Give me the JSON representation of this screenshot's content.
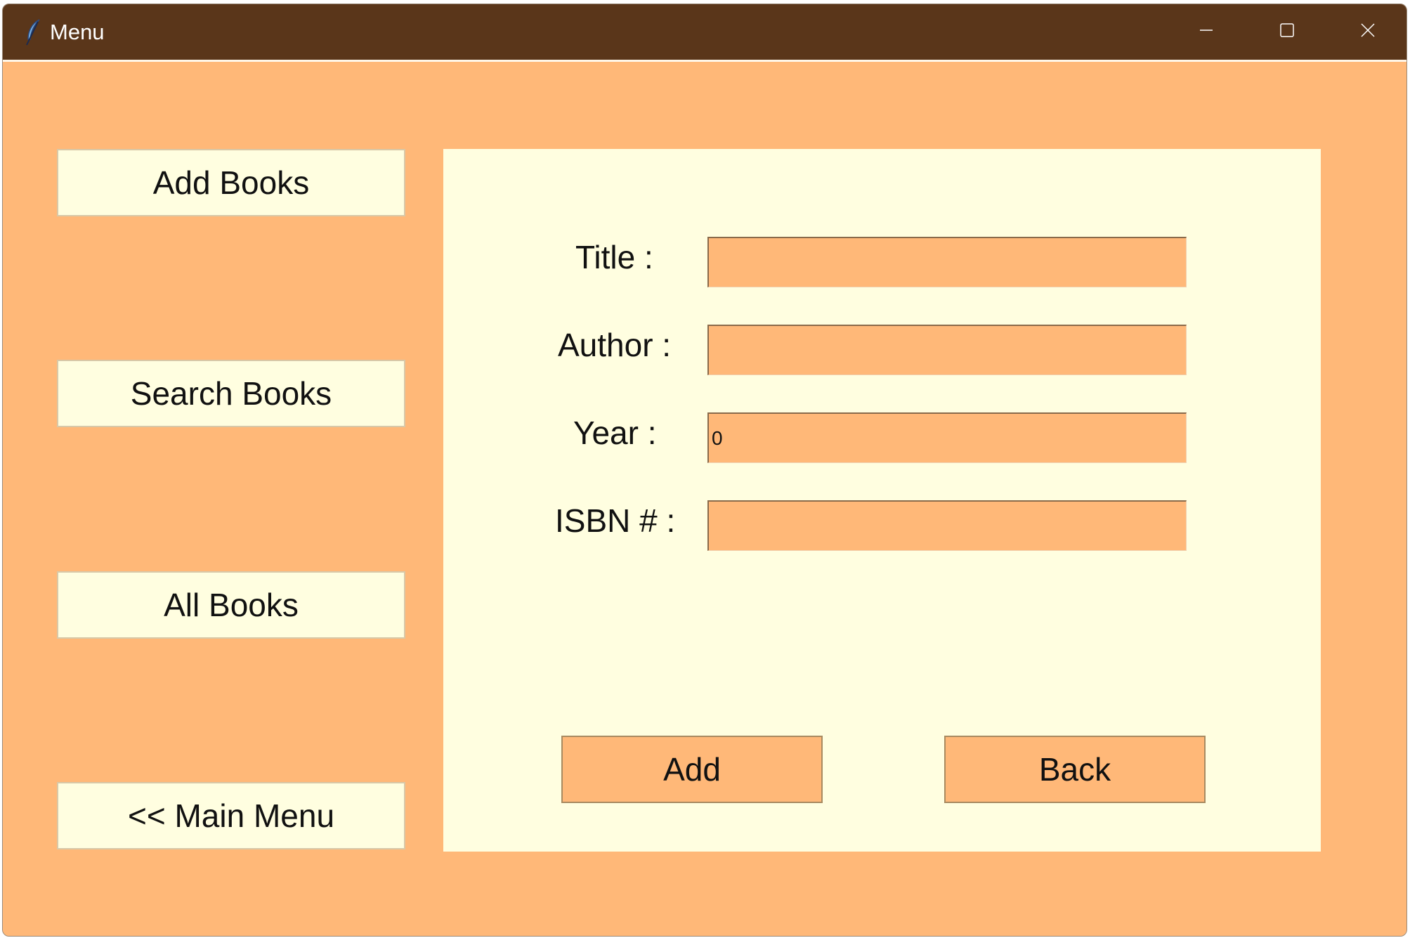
{
  "window": {
    "title": "Menu"
  },
  "sidebar": {
    "buttons": [
      {
        "label": "Add Books"
      },
      {
        "label": "Search Books"
      },
      {
        "label": "All Books"
      },
      {
        "label": "<< Main Menu"
      }
    ]
  },
  "form": {
    "fields": [
      {
        "label": "Title :",
        "value": ""
      },
      {
        "label": "Author :",
        "value": ""
      },
      {
        "label": "Year :",
        "value": "0"
      },
      {
        "label": "ISBN # :",
        "value": ""
      }
    ],
    "add_label": "Add",
    "back_label": "Back"
  },
  "colors": {
    "titlebar": "#5a361a",
    "background": "#ffb878",
    "panel": "#fffee0"
  },
  "icons": {
    "app": "feather-icon",
    "minimize": "minimize-icon",
    "maximize": "maximize-icon",
    "close": "close-icon"
  }
}
